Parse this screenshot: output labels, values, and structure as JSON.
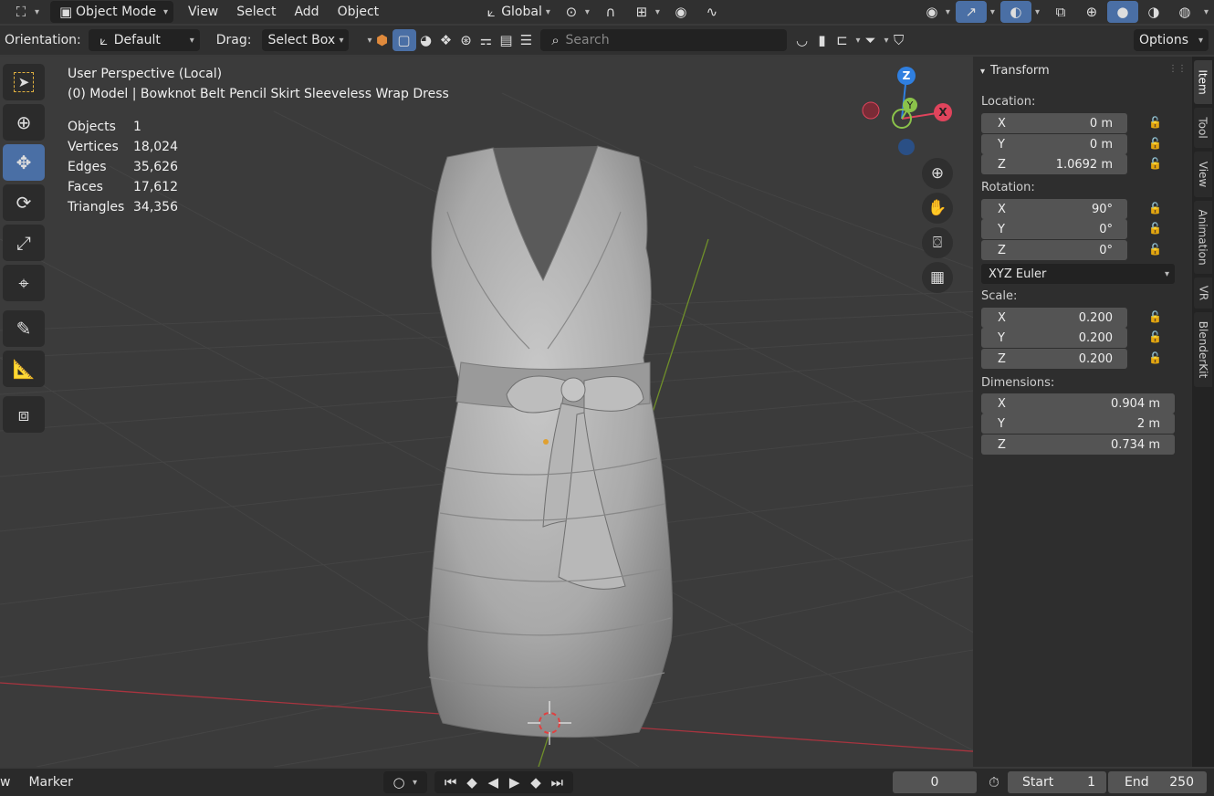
{
  "topbar": {
    "editor_icon": "editor-type-icon",
    "mode": "Object Mode",
    "menus": [
      "View",
      "Select",
      "Add",
      "Object"
    ],
    "orientation": "Global"
  },
  "tooloptions": {
    "orientation_label": "Orientation:",
    "orientation_value": "Default",
    "drag_label": "Drag:",
    "drag_value": "Select Box",
    "search_placeholder": "Search",
    "options_label": "Options"
  },
  "overlay": {
    "view_name": "User Perspective (Local)",
    "object_name": "(0) Model | Bowknot Belt Pencil Skirt Sleeveless Wrap Dress",
    "stats": [
      {
        "label": "Objects",
        "value": "1"
      },
      {
        "label": "Vertices",
        "value": "18,024"
      },
      {
        "label": "Edges",
        "value": "35,626"
      },
      {
        "label": "Faces",
        "value": "17,612"
      },
      {
        "label": "Triangles",
        "value": "34,356"
      }
    ]
  },
  "gizmo": {
    "x": "X",
    "y": "Y",
    "z": "Z"
  },
  "npanel": {
    "header": "Transform",
    "location_label": "Location:",
    "location": [
      {
        "axis": "X",
        "value": "0 m"
      },
      {
        "axis": "Y",
        "value": "0 m"
      },
      {
        "axis": "Z",
        "value": "1.0692 m"
      }
    ],
    "rotation_label": "Rotation:",
    "rotation": [
      {
        "axis": "X",
        "value": "90°"
      },
      {
        "axis": "Y",
        "value": "0°"
      },
      {
        "axis": "Z",
        "value": "0°"
      }
    ],
    "rotation_mode": "XYZ Euler",
    "scale_label": "Scale:",
    "scale": [
      {
        "axis": "X",
        "value": "0.200"
      },
      {
        "axis": "Y",
        "value": "0.200"
      },
      {
        "axis": "Z",
        "value": "0.200"
      }
    ],
    "dimensions_label": "Dimensions:",
    "dimensions": [
      {
        "axis": "X",
        "value": "0.904 m"
      },
      {
        "axis": "Y",
        "value": "2 m"
      },
      {
        "axis": "Z",
        "value": "0.734 m"
      }
    ]
  },
  "tabs": [
    "Item",
    "Tool",
    "View",
    "Animation",
    "VR",
    "BlenderKit"
  ],
  "timeline": {
    "view_partial": "w",
    "marker": "Marker",
    "current_frame": "0",
    "start_label": "Start",
    "start_value": "1",
    "end_label": "End",
    "end_value": "250"
  },
  "colors": {
    "accent": "#4a6fa5",
    "x_axis": "#e0445c",
    "y_axis": "#8bc34a",
    "z_axis": "#2f7fe0"
  }
}
